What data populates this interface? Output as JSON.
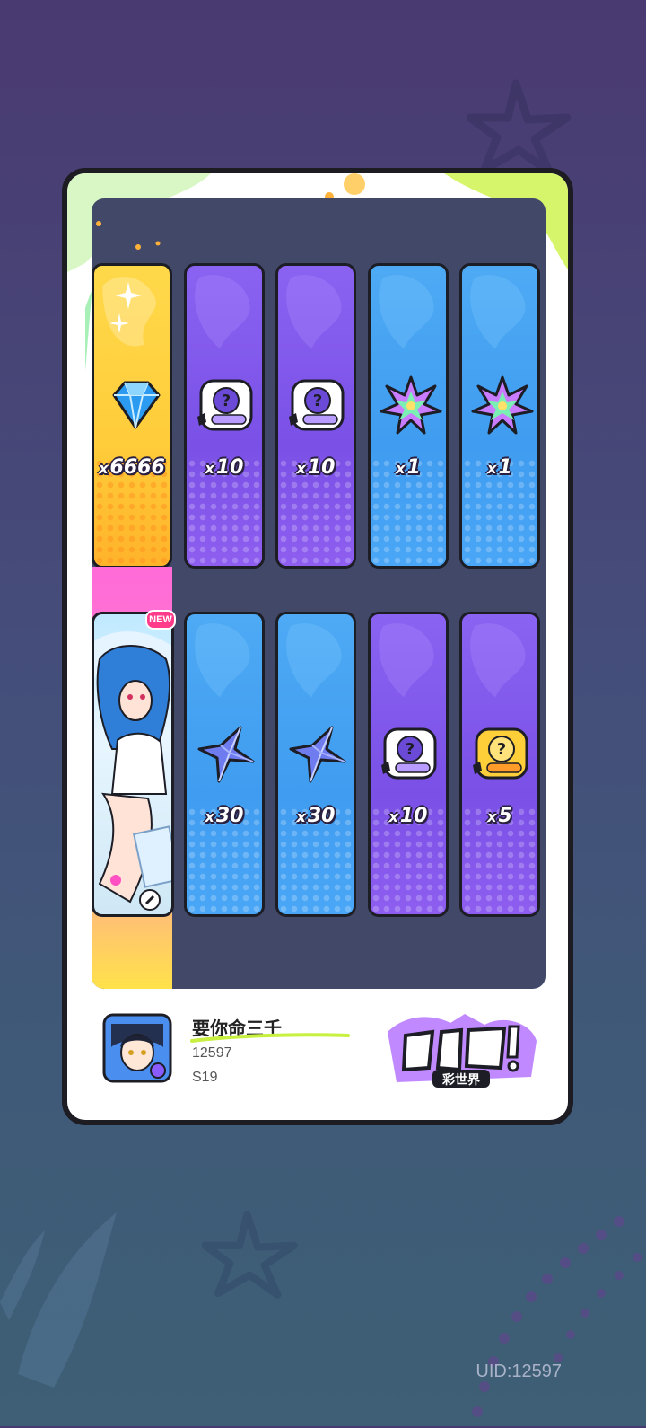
{
  "rewards_row1": [
    {
      "qty": "6666",
      "type": "gold",
      "icon": "diamond-gem-icon"
    },
    {
      "qty": "10",
      "type": "purple",
      "icon": "mystery-ticket-purple-icon"
    },
    {
      "qty": "10",
      "type": "purple",
      "icon": "mystery-ticket-purple-icon"
    },
    {
      "qty": "1",
      "type": "blue",
      "icon": "rainbow-leaf-icon"
    },
    {
      "qty": "1",
      "type": "blue",
      "icon": "rainbow-leaf-icon"
    }
  ],
  "rewards_row2": [
    {
      "qty": "30",
      "type": "blue",
      "icon": "blue-star-shard-icon"
    },
    {
      "qty": "30",
      "type": "blue",
      "icon": "blue-star-shard-icon"
    },
    {
      "qty": "10",
      "type": "purple",
      "icon": "mystery-ticket-purple-icon"
    },
    {
      "qty": "5",
      "type": "purple",
      "icon": "mystery-ticket-gold-icon"
    }
  ],
  "qty_prefix": "x",
  "new_badge": "NEW",
  "player": {
    "name": "要你命三千",
    "id": "12597",
    "server": "S19"
  },
  "logo_text": "彩世界",
  "uid_label": "UID:12597",
  "colors": {
    "purple_slot": "#7a50e6",
    "blue_slot": "#3f9cf0",
    "gold_slot": "#ffcc3a",
    "panel": "#424968"
  }
}
